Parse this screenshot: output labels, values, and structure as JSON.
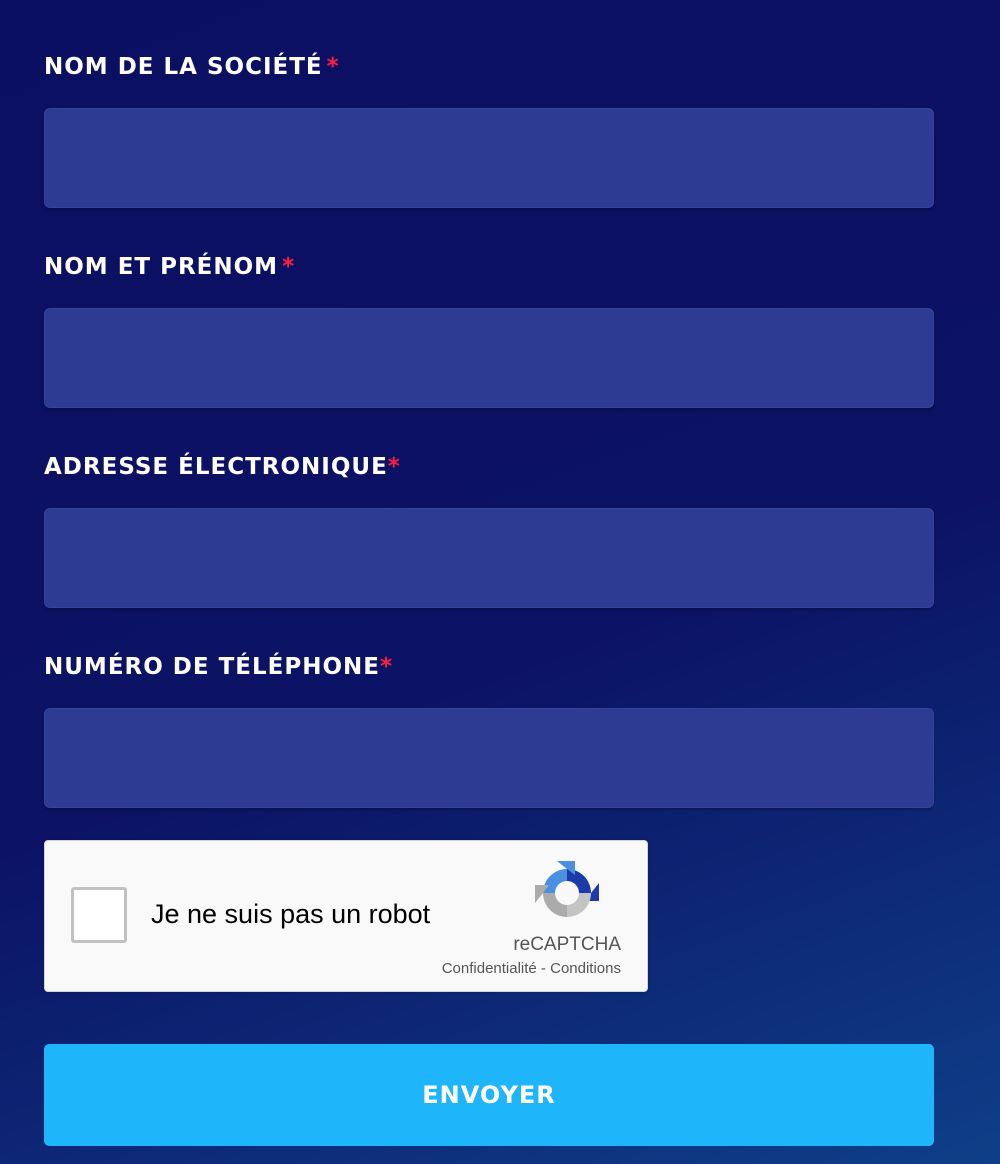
{
  "form": {
    "fields": [
      {
        "label": "NOM DE LA SOCIÉTÉ",
        "required_marker": "*",
        "value": "",
        "placeholder": ""
      },
      {
        "label": "NOM ET PRÉNOM",
        "required_marker": "*",
        "value": "",
        "placeholder": ""
      },
      {
        "label": "ADRESSE ÉLECTRONIQUE",
        "required_marker": "*",
        "value": "",
        "placeholder": ""
      },
      {
        "label": "NUMÉRO DE TÉLÉPHONE",
        "required_marker": "*",
        "value": "",
        "placeholder": ""
      }
    ],
    "submit_label": "ENVOYER"
  },
  "captcha": {
    "checkbox_label": "Je ne suis pas un robot",
    "checked": false,
    "brand": "reCAPTCHA",
    "privacy_link": "Confidentialité",
    "separator": " - ",
    "terms_link": "Conditions",
    "logo_icon": "recaptcha-logo-icon"
  },
  "colors": {
    "background": "#0b0f62",
    "input_background": "#2e3b92",
    "required_marker": "#ff1e3c",
    "submit_button": "#1fb5fb",
    "label_text": "#ffffff"
  }
}
